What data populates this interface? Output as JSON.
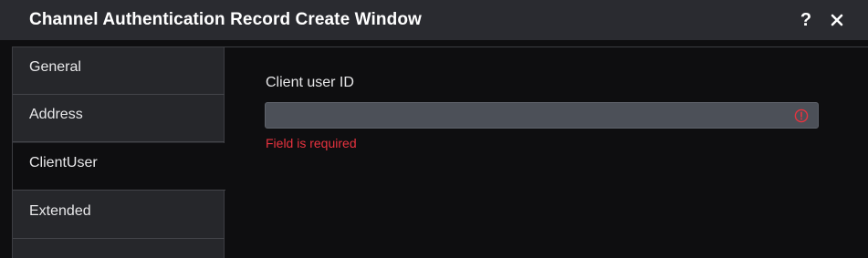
{
  "window": {
    "title": "Channel Authentication Record Create Window",
    "help_label": "?",
    "close_label": "×"
  },
  "sidebar": {
    "items": [
      {
        "label": "General"
      },
      {
        "label": "Address"
      },
      {
        "label": "ClientUser"
      },
      {
        "label": "Extended"
      }
    ],
    "active": "ClientUser"
  },
  "form": {
    "client_user_id": {
      "label": "Client user ID",
      "value": "",
      "error": "Field is required"
    }
  },
  "colors": {
    "error": "#e8333f",
    "titlebar": "#2a2b30",
    "sidebar": "#26272b"
  }
}
